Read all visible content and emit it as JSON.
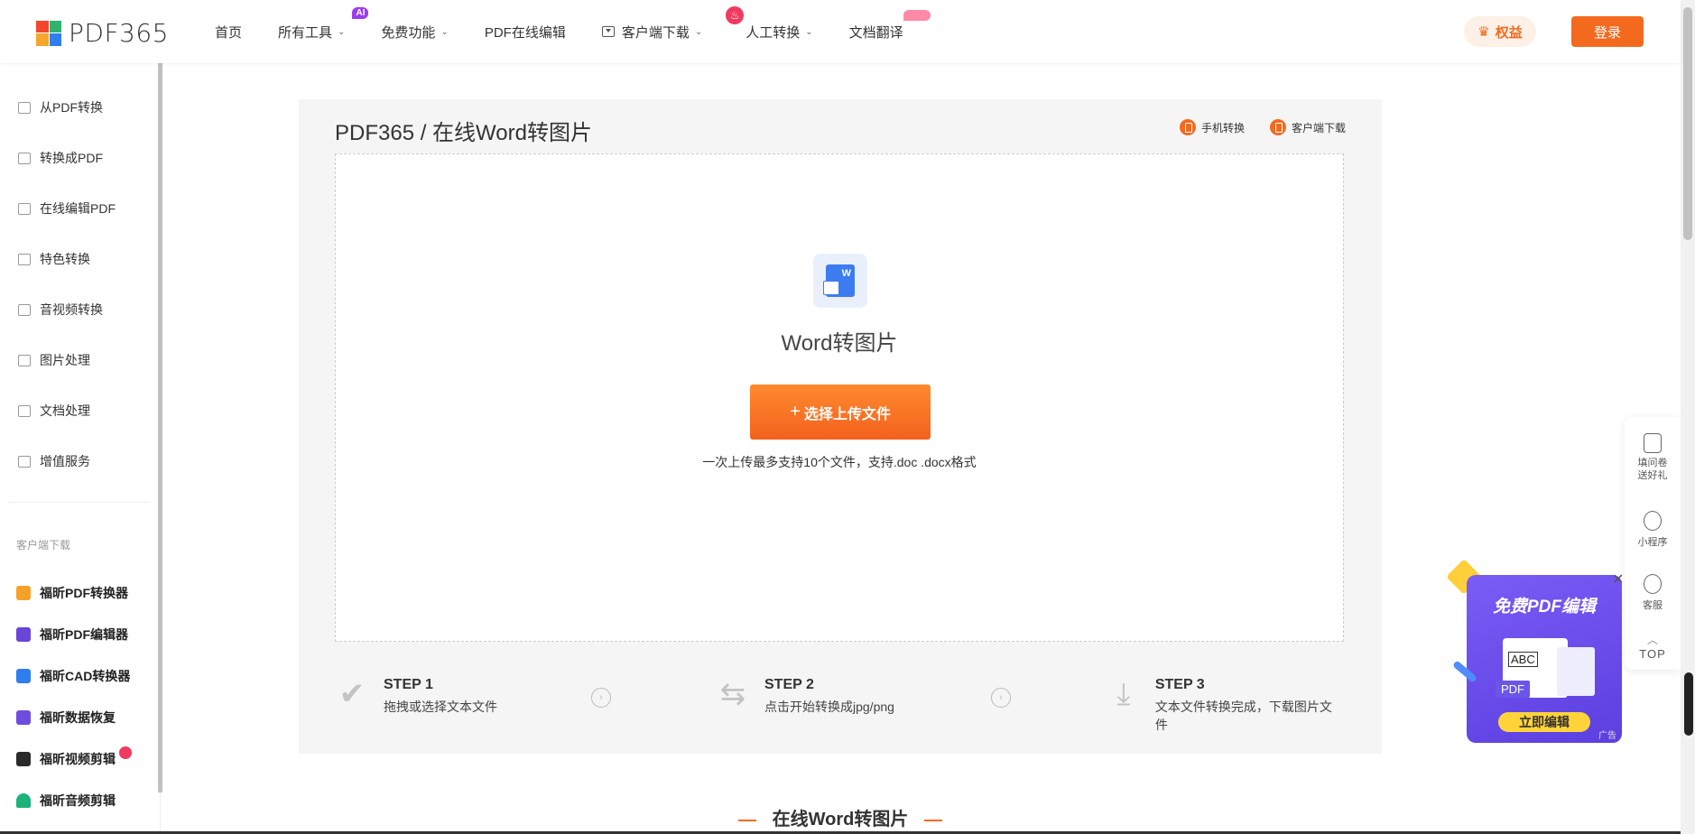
{
  "header": {
    "logo_text": "PDF365",
    "nav": [
      {
        "label": "首页"
      },
      {
        "label": "所有工具",
        "badge": "AI"
      },
      {
        "label": "免费功能"
      },
      {
        "label": "PDF在线编辑"
      },
      {
        "label": "客户端下载"
      },
      {
        "label": "人工转换"
      },
      {
        "label": "文档翻译"
      }
    ],
    "perks_label": "权益",
    "login_label": "登录"
  },
  "sidebar": {
    "items": [
      {
        "label": "从PDF转换"
      },
      {
        "label": "转换成PDF"
      },
      {
        "label": "在线编辑PDF"
      },
      {
        "label": "特色转换"
      },
      {
        "label": "音视频转换"
      },
      {
        "label": "图片处理"
      },
      {
        "label": "文档处理"
      },
      {
        "label": "增值服务"
      }
    ],
    "caption": "客户端下载",
    "apps": [
      {
        "label": "福昕PDF转换器",
        "color": "#f4a12a"
      },
      {
        "label": "福昕PDF编辑器",
        "color": "#6a45d8"
      },
      {
        "label": "福昕CAD转换器",
        "color": "#2f7ef0"
      },
      {
        "label": "福昕数据恢复",
        "color": "#6d4de0"
      },
      {
        "label": "福昕视频剪辑",
        "color": "#2b2b2b"
      },
      {
        "label": "福昕音频剪辑",
        "color": "#1db27a"
      }
    ]
  },
  "main": {
    "breadcrumb": "PDF365 / 在线Word转图片",
    "links": {
      "mobile": "手机转换",
      "client": "客户端下载"
    },
    "tool_title": "Word转图片",
    "word_icon_letter": "W",
    "upload_button": "选择上传文件",
    "upload_note": "一次上传最多支持10个文件，支持.doc .docx格式",
    "steps": [
      {
        "title": "STEP 1",
        "desc": "拖拽或选择文本文件"
      },
      {
        "title": "STEP 2",
        "desc": "点击开始转换成jpg/png"
      },
      {
        "title": "STEP 3",
        "desc": "文本文件转换完成，下载图片文件"
      }
    ],
    "section_title": "在线Word转图片"
  },
  "rail": {
    "items": [
      {
        "label": "填问卷送好礼"
      },
      {
        "label": "小程序"
      },
      {
        "label": "客服"
      },
      {
        "label": "TOP"
      }
    ]
  },
  "ad": {
    "title": "免费PDF编辑",
    "abc": "ABC",
    "pdf": "PDF",
    "button": "立即编辑",
    "tag": "广告"
  },
  "colors": {
    "accent": "#f36a1f",
    "ad_bg": "#6a4ff0"
  }
}
